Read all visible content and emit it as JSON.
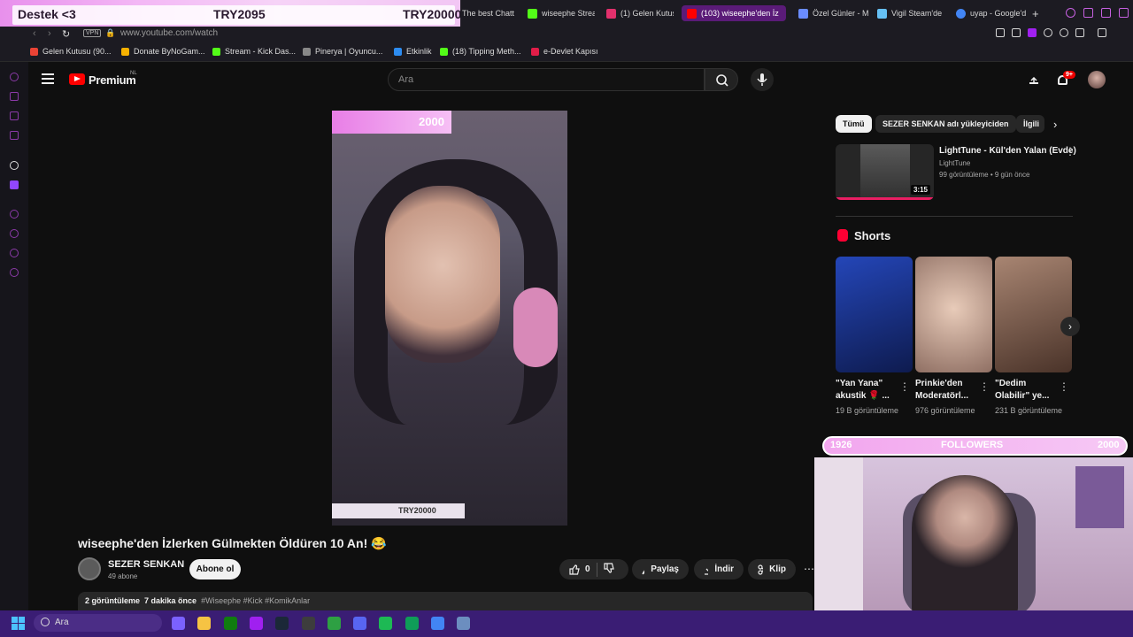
{
  "overlay_top": {
    "left": "Destek <3",
    "middle": "TRY2095",
    "right": "TRY20000"
  },
  "tabs": [
    {
      "label": "The best Chatt",
      "color": "#2c2c2c"
    },
    {
      "label": "wiseephe Strea",
      "color": "#53fc18"
    },
    {
      "label": "(1) Gelen Kutusu",
      "color": "#e1306c"
    },
    {
      "label": "(103) wiseephe'den İz",
      "color": "#ff0000",
      "active": true
    },
    {
      "label": "Özel Günler - M",
      "color": "#6a8cff"
    },
    {
      "label": "Vigil Steam'de",
      "color": "#66c0f4"
    },
    {
      "label": "uyap - Google'd",
      "color": "#4285f4"
    }
  ],
  "address": {
    "vpn": "VPN",
    "url": "www.youtube.com/watch"
  },
  "bookmarks": [
    {
      "label": "Gelen Kutusu (90...",
      "color": "#ea4335"
    },
    {
      "label": "Donate ByNoGam...",
      "color": "#f6b100"
    },
    {
      "label": "Stream - Kick Das...",
      "color": "#53fc18"
    },
    {
      "label": "Pinerya | Oyuncu...",
      "color": "#888888"
    },
    {
      "label": "Etkinlik",
      "color": "#2d8cf0"
    },
    {
      "label": "(18) Tipping Meth...",
      "color": "#53fc18"
    },
    {
      "label": "e-Devlet Kapısı",
      "color": "#e11d48"
    }
  ],
  "youtube": {
    "brand": "Premium",
    "region": "NL",
    "search_placeholder": "Ara",
    "notif_count": "9+"
  },
  "player": {
    "overlay_count": "2000",
    "overlay_try": "TRY20000"
  },
  "video": {
    "title": "wiseephe'den İzlerken Gülmekten Öldüren 10 An! 😂",
    "channel": "SEZER SENKAN",
    "subs": "49 abone",
    "subscribe": "Abone ol",
    "likes": "0",
    "share": "Paylaş",
    "download": "İndir",
    "clip": "Klip",
    "views": "2 görüntüleme",
    "age": "7 dakika önce",
    "tags": "#Wiseephe #Kick #KomikAnlar"
  },
  "chips": [
    "Tümü",
    "SEZER SENKAN adı yükleyiciden",
    "İlgili"
  ],
  "recommended": {
    "title": "LightTune - Kül'den Yalan (Evde)",
    "channel": "LightTune",
    "meta": "99 görüntüleme • 9 gün önce",
    "duration": "3:15"
  },
  "shorts": {
    "title": "Shorts",
    "items": [
      {
        "title": "\"Yan Yana\" akustik 🌹 ...",
        "views": "19 B görüntüleme",
        "color": "#1a3a8a"
      },
      {
        "title": "Prinkie'den Moderatörl...",
        "views": "976 görüntüleme",
        "color": "#c9a79a"
      },
      {
        "title": "\"Dedim Olabilir\" ye...",
        "views": "231 B görüntüleme",
        "color": "#7a5a4a"
      }
    ]
  },
  "followers_overlay": {
    "left": "1926",
    "center": "FOLLOWERS",
    "right": "2000"
  },
  "taskbar": {
    "search": "Ara",
    "apps": [
      {
        "name": "copilot-icon",
        "color": "#7b61ff"
      },
      {
        "name": "file-explorer-icon",
        "color": "#f6c343"
      },
      {
        "name": "xbox-icon",
        "color": "#107c10"
      },
      {
        "name": "opera-icon",
        "color": "#a020f0"
      },
      {
        "name": "steam-icon",
        "color": "#1b2838"
      },
      {
        "name": "obs-icon",
        "color": "#3d3d3d"
      },
      {
        "name": "app-icon",
        "color": "#2ea043"
      },
      {
        "name": "discord-icon",
        "color": "#5865f2"
      },
      {
        "name": "spotify-icon",
        "color": "#1db954"
      },
      {
        "name": "app2-icon",
        "color": "#0f9d58"
      },
      {
        "name": "chrome-icon",
        "color": "#4285f4"
      },
      {
        "name": "tool-icon",
        "color": "#6c8ebf"
      }
    ]
  }
}
